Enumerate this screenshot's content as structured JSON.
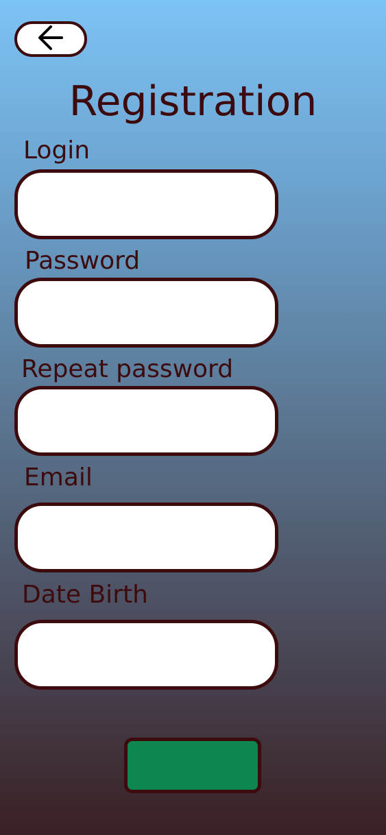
{
  "header": {
    "title": "Registration",
    "back_icon": "arrow-left-icon"
  },
  "form": {
    "fields": [
      {
        "label": "Login",
        "value": "",
        "placeholder": ""
      },
      {
        "label": "Password",
        "value": "",
        "placeholder": ""
      },
      {
        "label": "Repeat password",
        "value": "",
        "placeholder": ""
      },
      {
        "label": "Email",
        "value": "",
        "placeholder": ""
      },
      {
        "label": "Date Birth",
        "value": "",
        "placeholder": ""
      }
    ],
    "submit_label": ""
  },
  "colors": {
    "text": "#3d0a0d",
    "submit": "#0d874f",
    "gradient_top": "#7cc3f5",
    "gradient_bottom": "#3a2024"
  }
}
